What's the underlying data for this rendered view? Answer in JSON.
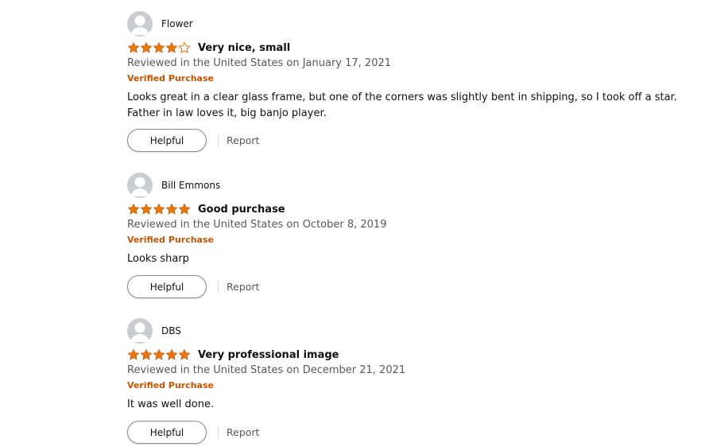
{
  "reviews": [
    {
      "author": "Flower",
      "rating": 4,
      "title": "Very nice, small",
      "date": "Reviewed in the United States on January 17, 2021",
      "verified": "Verified Purchase",
      "body_lines": [
        "Looks great in a clear glass frame, but one of the corners was slightly bent in shipping, so I took off a star.",
        "Father in law loves it, big banjo player."
      ],
      "helpful_label": "Helpful",
      "report_label": "Report"
    },
    {
      "author": "Bill Emmons",
      "rating": 5,
      "title": "Good purchase",
      "date": "Reviewed in the United States on October 8, 2019",
      "verified": "Verified Purchase",
      "body_lines": [
        "Looks sharp"
      ],
      "helpful_label": "Helpful",
      "report_label": "Report"
    },
    {
      "author": "DBS",
      "rating": 5,
      "title": "Very professional image",
      "date": "Reviewed in the United States on December 21, 2021",
      "verified": "Verified Purchase",
      "body_lines": [
        "It was well done."
      ],
      "helpful_label": "Helpful",
      "report_label": "Report"
    }
  ],
  "colors": {
    "star": "#e47911",
    "verified": "#c45500",
    "secondary_text": "#565959"
  }
}
